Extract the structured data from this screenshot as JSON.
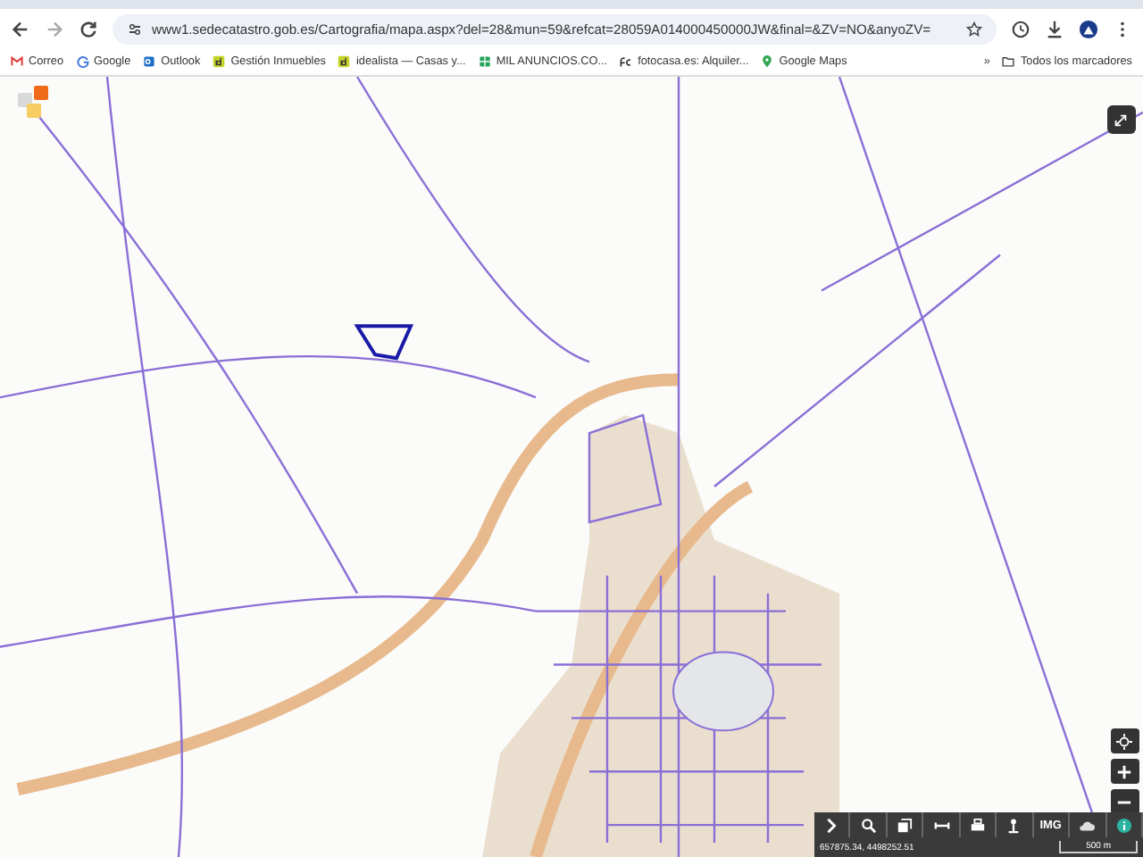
{
  "browser": {
    "url": "www1.sedecatastro.gob.es/Cartografia/mapa.aspx?del=28&mun=59&refcat=28059A014000450000JW&final=&ZV=NO&anyoZV=",
    "bookmarks": [
      {
        "label": "Correo",
        "kind": "mail"
      },
      {
        "label": "Google",
        "kind": "g"
      },
      {
        "label": "Outlook",
        "kind": "outlook"
      },
      {
        "label": "Gestión Inmuebles",
        "kind": "id"
      },
      {
        "label": "idealista — Casas y...",
        "kind": "id"
      },
      {
        "label": "MIL ANUNCIOS.CO...",
        "kind": "sheet"
      },
      {
        "label": "fotocasa.es: Alquiler...",
        "kind": "fc"
      },
      {
        "label": "Google Maps",
        "kind": "pin"
      }
    ],
    "overflow": "»",
    "all_bookmarks": "Todos los marcadores"
  },
  "map": {
    "toolbar": [
      {
        "kind": "expand"
      },
      {
        "kind": "search"
      },
      {
        "kind": "layers"
      },
      {
        "kind": "measure"
      },
      {
        "kind": "print"
      },
      {
        "kind": "person"
      },
      {
        "kind": "text",
        "label": "IMG"
      },
      {
        "kind": "cloud"
      },
      {
        "kind": "info"
      }
    ],
    "coordinates": "657875.34, 4498252.51",
    "scale": "500 m"
  }
}
